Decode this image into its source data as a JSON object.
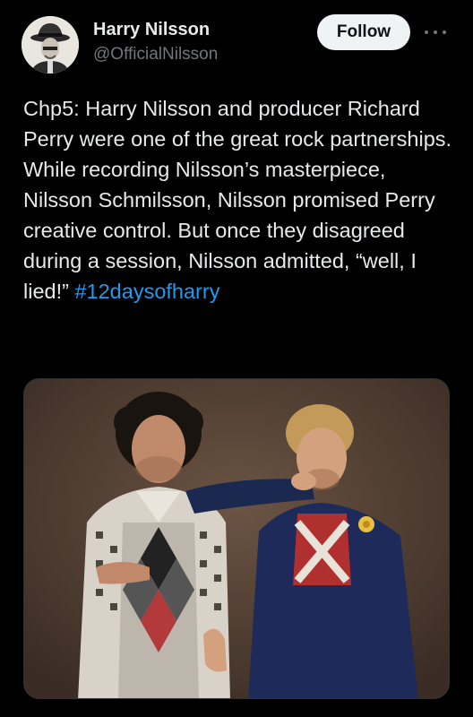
{
  "author": {
    "display_name": "Harry Nilsson",
    "handle": "@OfficialNilsson",
    "avatar_icon": "portrait-avatar-icon"
  },
  "actions": {
    "follow_label": "Follow",
    "more_icon": "more-horizontal-icon"
  },
  "tweet": {
    "text": "Chp5: Harry Nilsson and producer Richard Perry were one of the great rock partnerships. While recording Nilsson’s masterpiece, Nilsson Schmilsson, Nilsson promised Perry creative control. But once they disagreed during a session, Nilsson admitted, “well, I lied!”",
    "hashtag": "#12daysofharry"
  },
  "media": {
    "description_icon": "photo-two-men-icon"
  },
  "colors": {
    "background": "#000000",
    "text": "#e7e9ea",
    "secondary_text": "#71767b",
    "link": "#1d9bf0",
    "follow_bg": "#eff3f4"
  }
}
